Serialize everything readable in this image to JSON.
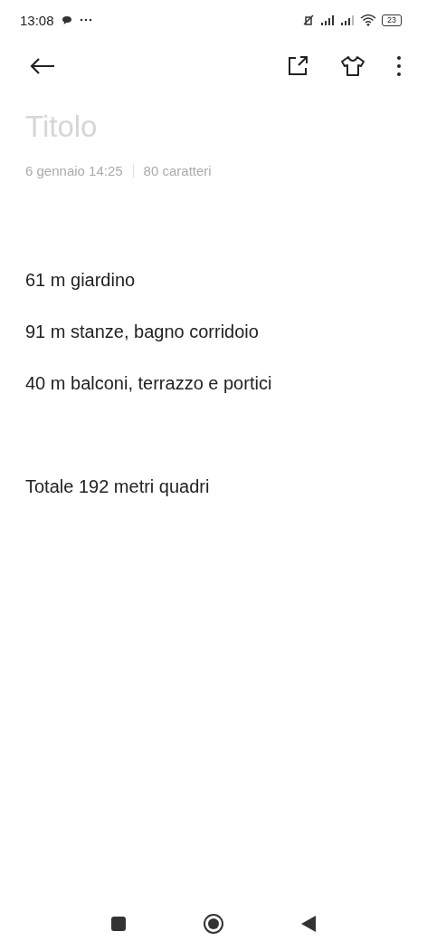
{
  "status_bar": {
    "time": "13:08",
    "battery": "23"
  },
  "note": {
    "title": {
      "placeholder": "Titolo"
    },
    "date": "6 gennaio 14:25",
    "count": "80 caratteri",
    "blocks": [
      {
        "lines": [
          "61 m giardino",
          "91 m stanze, bagno corridoio",
          "40 m balconi, terrazzo e portici"
        ]
      },
      {
        "lines": [
          "Totale 192 metri quadri"
        ]
      }
    ]
  }
}
